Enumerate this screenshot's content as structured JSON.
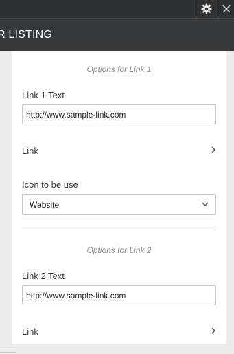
{
  "topbar": {
    "icons": {
      "settings": "gear-icon",
      "close": "close-icon"
    }
  },
  "header": {
    "title": "R LISTING"
  },
  "section1": {
    "caption": "Options for Link 1",
    "text_label": "Link 1 Text",
    "text_value": "http://www.sample-link.com",
    "link_label": "Link",
    "icon_label": "Icon to be use",
    "icon_value": "Website"
  },
  "section2": {
    "caption": "Options for Link 2",
    "text_label": "Link 2 Text",
    "text_value": "http://www.sample-link.com",
    "link_label": "Link"
  },
  "colors": {
    "topbar": "#2f3133",
    "header": "#36393b",
    "panel": "#ffffff",
    "background": "#ebebeb"
  }
}
